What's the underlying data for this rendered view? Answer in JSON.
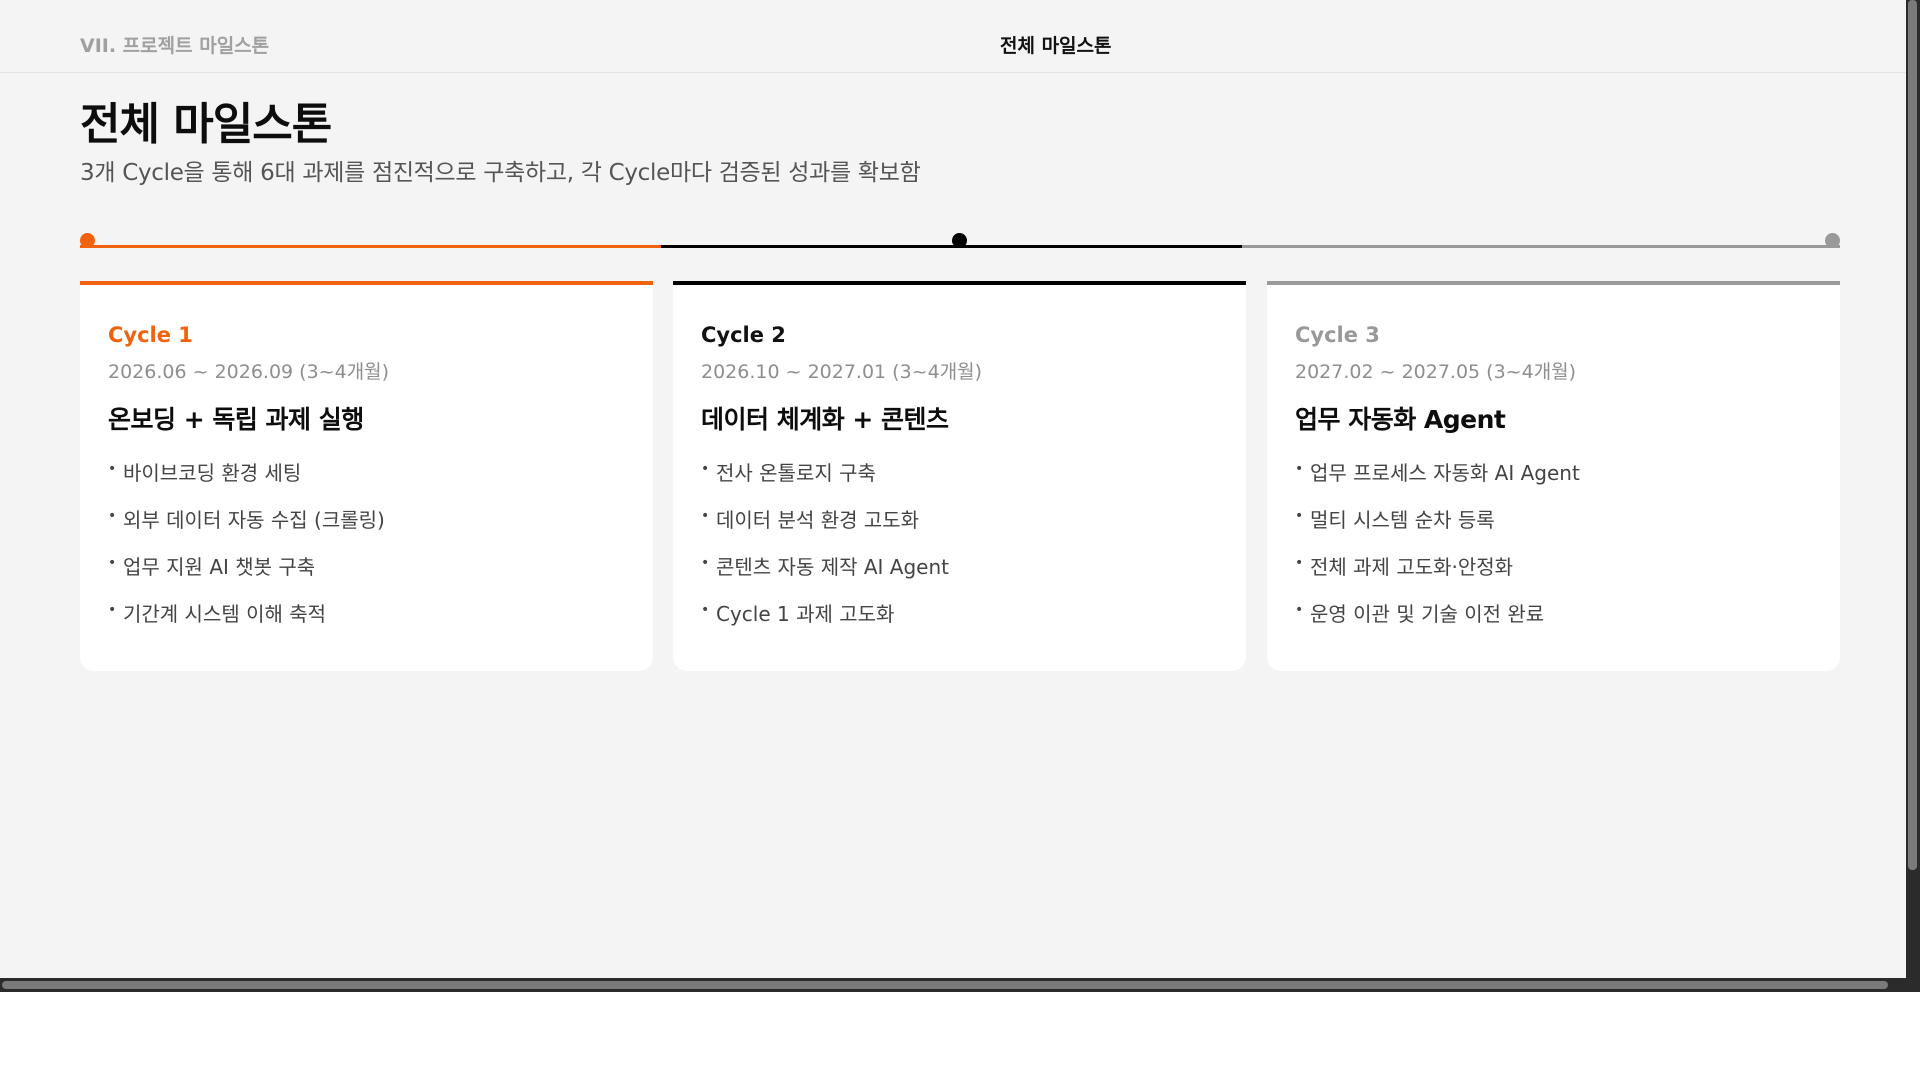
{
  "header": {
    "section_label": "VII. 프로젝트 마일스톤",
    "title": "전체 마일스톤"
  },
  "page": {
    "title": "전체 마일스톤",
    "subtitle": "3개 Cycle을 통해 6대 과제를 점진적으로 구축하고, 각 Cycle마다 검증된 성과를 확보함"
  },
  "colors": {
    "cycle1": "#f0620d",
    "cycle2": "#000000",
    "cycle3": "#999999"
  },
  "cycles": [
    {
      "label": "Cycle 1",
      "period": "2026.06 ~ 2026.09 (3~4개월)",
      "heading": "온보딩 + 독립 과제 실행",
      "items": [
        "바이브코딩 환경 세팅",
        "외부 데이터 자동 수집 (크롤링)",
        "업무 지원 AI 챗봇 구축",
        "기간계 시스템 이해 축적"
      ]
    },
    {
      "label": "Cycle 2",
      "period": "2026.10 ~ 2027.01 (3~4개월)",
      "heading": "데이터 체계화 + 콘텐츠",
      "items": [
        "전사 온톨로지 구축",
        "데이터 분석 환경 고도화",
        "콘텐츠 자동 제작 AI Agent",
        "Cycle 1 과제 고도화"
      ]
    },
    {
      "label": "Cycle 3",
      "period": "2027.02 ~ 2027.05 (3~4개월)",
      "heading": "업무 자동화 Agent",
      "items": [
        "업무 프로세스 자동화 AI Agent",
        "멀티 시스템 순차 등록",
        "전체 과제 고도화·안정화",
        "운영 이관 및 기술 이전 완료"
      ]
    }
  ],
  "list_bullet": "•"
}
